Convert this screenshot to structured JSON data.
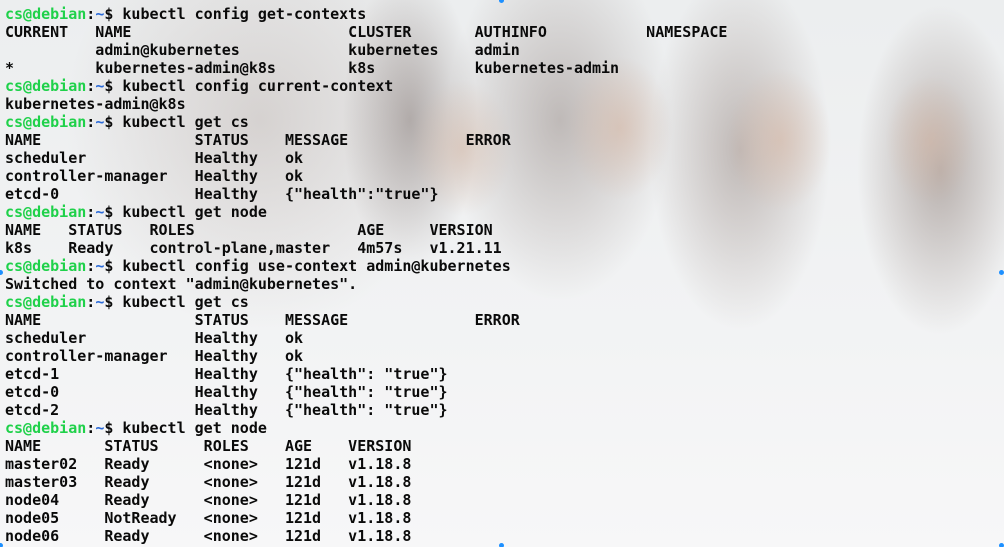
{
  "colors": {
    "user": "#1fd14a",
    "path": "#2a6ad8",
    "text": "#0a0a0a",
    "selection_handle": "#1e90ff"
  },
  "prompt": {
    "user": "cs@debian",
    "sep": ":",
    "path": "~",
    "symbol": "$"
  },
  "lines": [
    {
      "type": "cmd",
      "text": " kubectl config get-contexts"
    },
    {
      "type": "out",
      "text": "CURRENT   NAME                        CLUSTER       AUTHINFO           NAMESPACE"
    },
    {
      "type": "out",
      "text": "          admin@kubernetes            kubernetes    admin"
    },
    {
      "type": "out",
      "text": "*         kubernetes-admin@k8s        k8s           kubernetes-admin"
    },
    {
      "type": "cmd",
      "text": " kubectl config current-context"
    },
    {
      "type": "out",
      "text": "kubernetes-admin@k8s"
    },
    {
      "type": "cmd",
      "text": " kubectl get cs"
    },
    {
      "type": "out",
      "text": "NAME                 STATUS    MESSAGE             ERROR"
    },
    {
      "type": "out",
      "text": "scheduler            Healthy   ok"
    },
    {
      "type": "out",
      "text": "controller-manager   Healthy   ok"
    },
    {
      "type": "out",
      "text": "etcd-0               Healthy   {\"health\":\"true\"}"
    },
    {
      "type": "cmd",
      "text": " kubectl get node"
    },
    {
      "type": "out",
      "text": "NAME   STATUS   ROLES                  AGE     VERSION"
    },
    {
      "type": "out",
      "text": "k8s    Ready    control-plane,master   4m57s   v1.21.11"
    },
    {
      "type": "cmd",
      "text": " kubectl config use-context admin@kubernetes"
    },
    {
      "type": "out",
      "text": "Switched to context \"admin@kubernetes\"."
    },
    {
      "type": "cmd",
      "text": " kubectl get cs"
    },
    {
      "type": "out",
      "text": "NAME                 STATUS    MESSAGE              ERROR"
    },
    {
      "type": "out",
      "text": "scheduler            Healthy   ok"
    },
    {
      "type": "out",
      "text": "controller-manager   Healthy   ok"
    },
    {
      "type": "out",
      "text": "etcd-1               Healthy   {\"health\": \"true\"}"
    },
    {
      "type": "out",
      "text": "etcd-0               Healthy   {\"health\": \"true\"}"
    },
    {
      "type": "out",
      "text": "etcd-2               Healthy   {\"health\": \"true\"}"
    },
    {
      "type": "cmd",
      "text": " kubectl get node"
    },
    {
      "type": "out",
      "text": "NAME       STATUS     ROLES    AGE    VERSION"
    },
    {
      "type": "out",
      "text": "master02   Ready      <none>   121d   v1.18.8"
    },
    {
      "type": "out",
      "text": "master03   Ready      <none>   121d   v1.18.8"
    },
    {
      "type": "out",
      "text": "node04     Ready      <none>   121d   v1.18.8"
    },
    {
      "type": "out",
      "text": "node05     NotReady   <none>   121d   v1.18.8"
    },
    {
      "type": "out",
      "text": "node06     Ready      <none>   121d   v1.18.8"
    }
  ]
}
